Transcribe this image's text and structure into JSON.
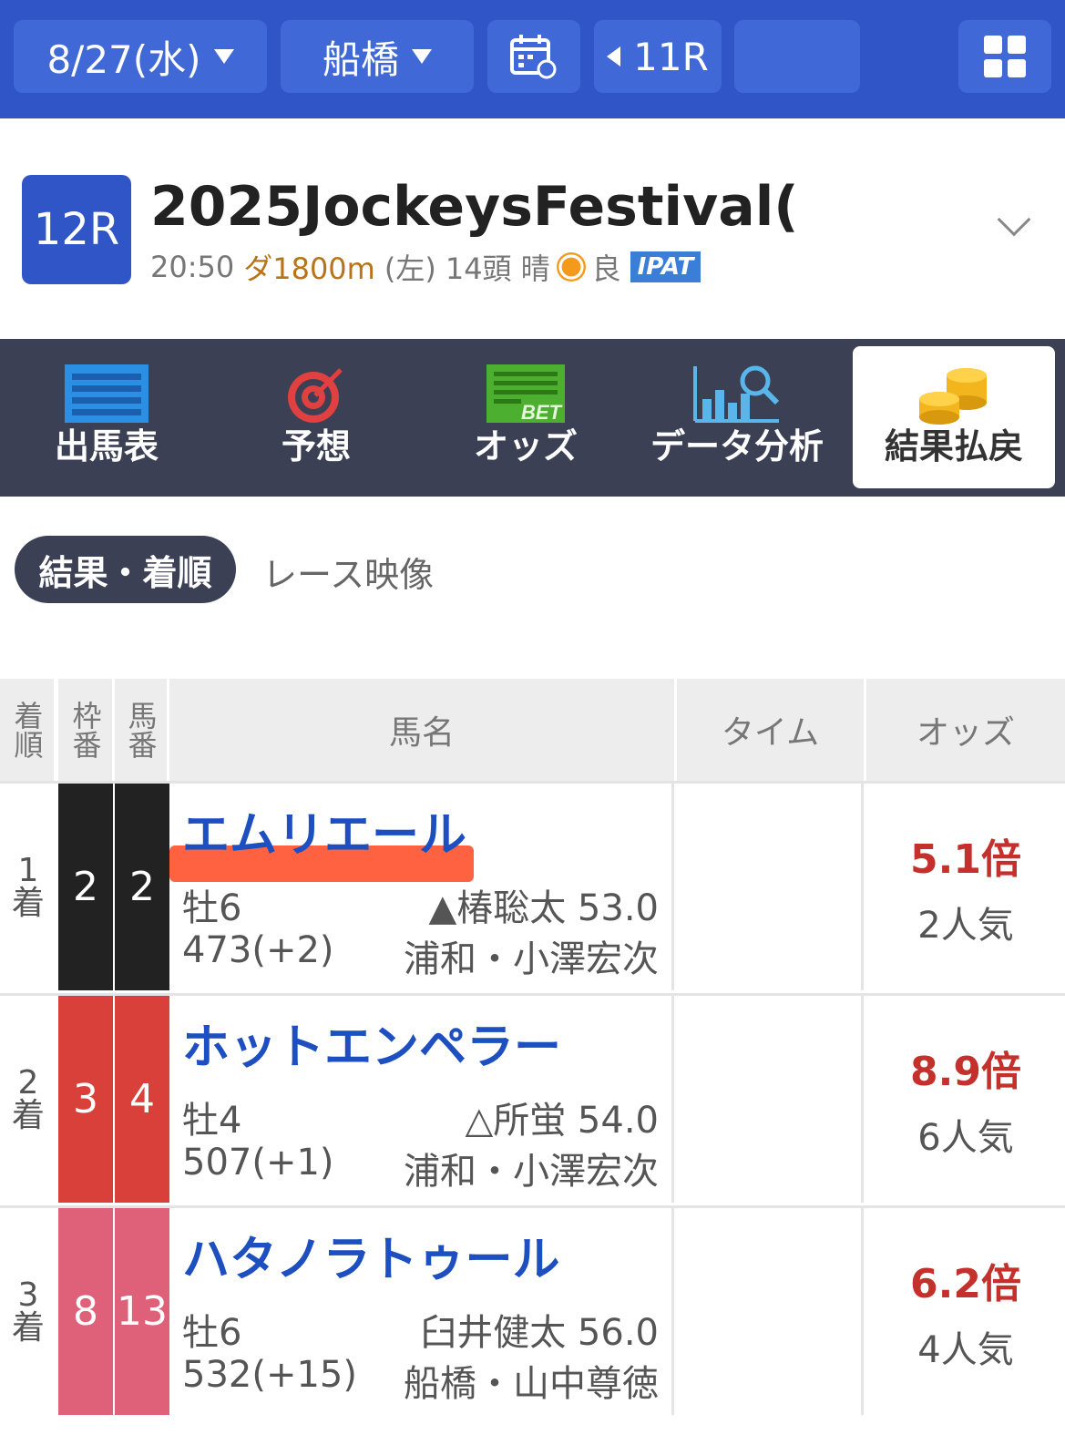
{
  "topbar": {
    "date": "8/27(水)",
    "place": "船橋",
    "prev_race": "11R",
    "colors": {
      "bar": "#2f55c6",
      "button": "#4069d7"
    }
  },
  "race": {
    "badge": "12R",
    "title": "2025JockeysFestival(",
    "time": "20:50",
    "course": "ダ1800m",
    "direction": "(左)",
    "runners": "14頭",
    "weather": "晴",
    "weather_icon": "sun-icon",
    "track": "良",
    "ipat": "IPAT"
  },
  "menu": {
    "items": [
      {
        "label": "出馬表",
        "icon": "entry-list-icon"
      },
      {
        "label": "予想",
        "icon": "target-icon"
      },
      {
        "label": "オッズ",
        "icon": "bet-icon"
      },
      {
        "label": "データ分析",
        "icon": "chart-search-icon"
      },
      {
        "label": "結果払戻",
        "icon": "coins-icon"
      }
    ],
    "active": "結果払戻"
  },
  "tabs": {
    "active": "結果・着順",
    "other": "レース映像"
  },
  "table": {
    "headers": {
      "rank": "着順",
      "waku": "枠番",
      "uma": "馬番",
      "name": "馬名",
      "time": "タイム",
      "odds": "オッズ"
    },
    "rows": [
      {
        "rank_num": "1",
        "rank_unit": "着",
        "waku": "2",
        "uma": "2",
        "waku_color": "#222222",
        "name": "エムリエール",
        "sexage": "牡6",
        "jockey": "▲椿聡太 53.0",
        "weight": "473(+2)",
        "trainer": "浦和・小澤宏次",
        "time": "",
        "odds": "5.1倍",
        "pop": "2人気"
      },
      {
        "rank_num": "2",
        "rank_unit": "着",
        "waku": "3",
        "uma": "4",
        "waku_color": "#d9403a",
        "name": "ホットエンペラー",
        "sexage": "牡4",
        "jockey": "△所蛍 54.0",
        "weight": "507(+1)",
        "trainer": "浦和・小澤宏次",
        "time": "",
        "odds": "8.9倍",
        "pop": "6人気"
      },
      {
        "rank_num": "3",
        "rank_unit": "着",
        "waku": "8",
        "uma": "13",
        "waku_color": "#de6079",
        "name": "ハタノラトゥール",
        "sexage": "牡6",
        "jockey": "臼井健太 56.0",
        "weight": "532(+15)",
        "trainer": "船橋・山中尊徳",
        "time": "",
        "odds": "6.2倍",
        "pop": "4人気"
      }
    ]
  }
}
